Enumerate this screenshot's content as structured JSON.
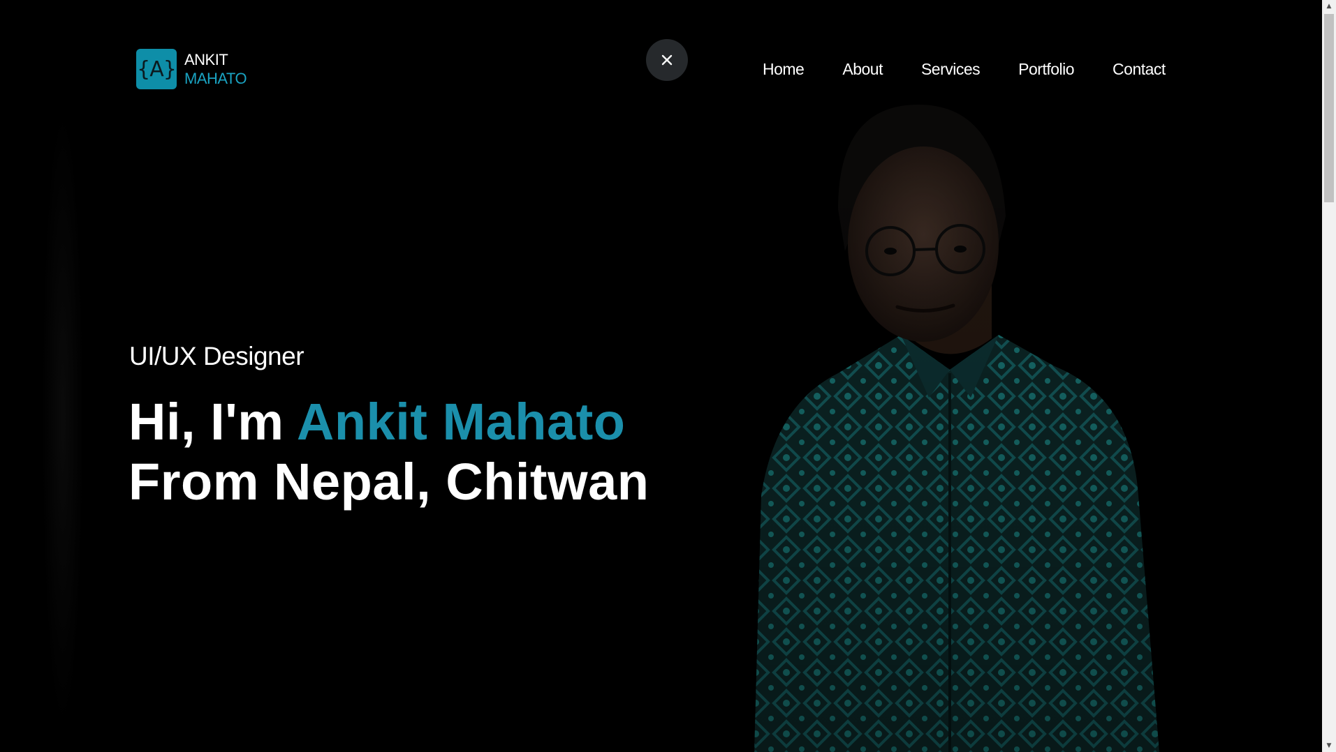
{
  "brand": {
    "badge_glyph": "{A}",
    "first_name": "ANKIT",
    "last_name": "MAHATO",
    "accent_color": "#1aa3c2"
  },
  "close_button": {
    "icon": "close-icon"
  },
  "nav": {
    "items": [
      {
        "label": "Home"
      },
      {
        "label": "About"
      },
      {
        "label": "Services"
      },
      {
        "label": "Portfolio"
      },
      {
        "label": "Contact"
      }
    ]
  },
  "hero": {
    "role": "UI/UX Designer",
    "greeting": "Hi, I'm ",
    "name": "Ankit Mahato",
    "location_line": "From Nepal, Chitwan",
    "accent_color": "#1b8fab"
  },
  "portrait": {
    "icon": "profile-photo-image"
  }
}
